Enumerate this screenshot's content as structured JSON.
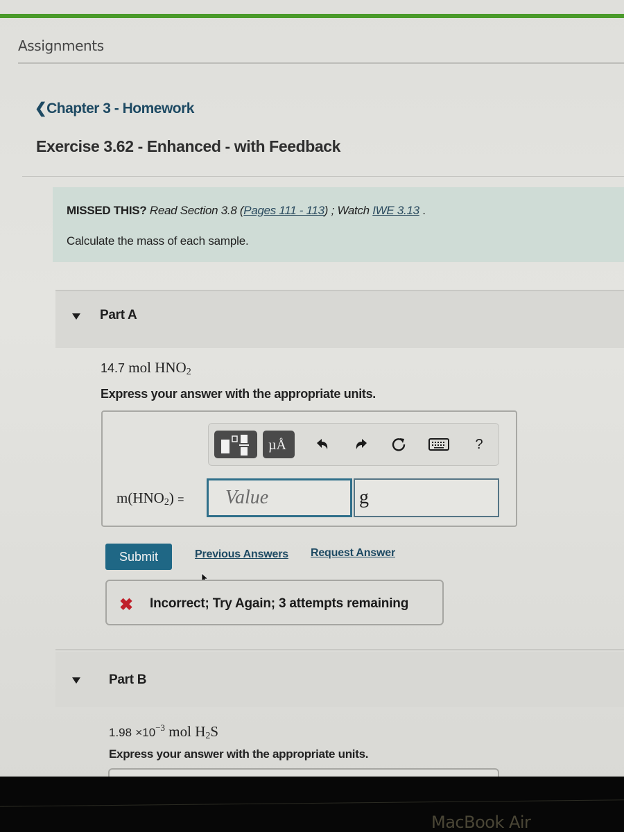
{
  "header": {
    "section_title": "Assignments",
    "back_link": "Chapter 3 - Homework",
    "exercise_title": "Exercise 3.62 - Enhanced - with Feedback"
  },
  "intro": {
    "missed_label": "MISSED THIS?",
    "read_text": "Read Section 3.8",
    "pages_link": "Pages 111 - 113",
    "watch_text": "; Watch",
    "iwe_link": "IWE 3.13",
    "instruction": "Calculate the mass of each sample."
  },
  "part_a": {
    "label": "Part A",
    "amount": "14.7",
    "unit_text": "mol",
    "formula_main": "HNO",
    "formula_sub": "2",
    "express": "Express your answer with the appropriate units.",
    "eq_prefix": "m(HNO",
    "eq_sub": "2",
    "eq_suffix": ")",
    "eq_sign": "=",
    "value_placeholder": "Value",
    "unit_value": "g",
    "toolbar": {
      "templates_icon": "templates-icon",
      "units_label": "µÅ",
      "undo_icon": "undo-icon",
      "redo_icon": "redo-icon",
      "reset_icon": "reset-icon",
      "keyboard_icon": "keyboard-icon",
      "help_label": "?"
    },
    "submit_label": "Submit",
    "previous_answers": "Previous Answers",
    "request_answer": "Request Answer",
    "feedback": {
      "icon": "✖",
      "text": "Incorrect; Try Again; 3 attempts remaining",
      "color": "#c0202a"
    }
  },
  "part_b": {
    "label": "Part B",
    "amount": "1.98",
    "times": "×10",
    "exponent": "−3",
    "unit_text": "mol",
    "formula_h": "H",
    "formula_sub": "2",
    "formula_s": "S",
    "express": "Express your answer with the appropriate units."
  },
  "device": {
    "label": "MacBook Air"
  },
  "colors": {
    "accent_bar": "#4a9a2a",
    "submit_bg": "#1f6785",
    "link": "#1e4a63",
    "hint_box": "#cfdcd6"
  }
}
